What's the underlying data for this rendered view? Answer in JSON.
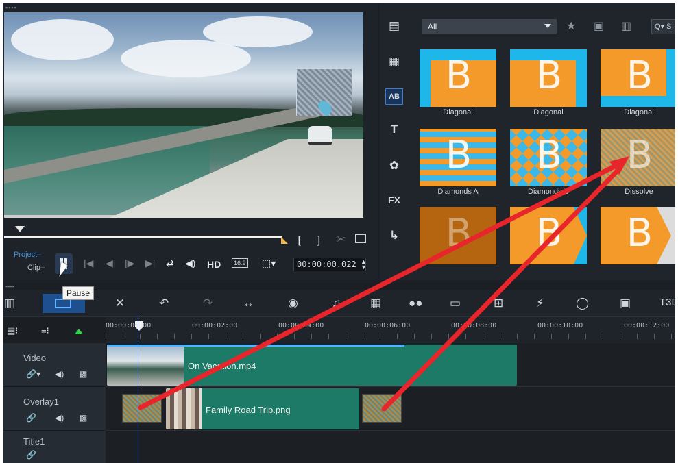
{
  "preview": {
    "mode_project": "Project",
    "mode_clip": "Clip",
    "tooltip": "Pause",
    "hd_label": "HD",
    "ratio_label": "16:9",
    "timecode": "00:00:00.022",
    "mark_in": "[",
    "mark_out": "]"
  },
  "library": {
    "filter_value": "All",
    "search_label": "Q▾ S",
    "rail_icons": [
      "media-icon",
      "instant-project-icon",
      "transition-icon",
      "title-icon",
      "graphics-icon",
      "filter-fx-icon",
      "path-icon"
    ],
    "rail_text": {
      "title": "T",
      "fx": "FX",
      "transition": "AB"
    },
    "tiles": [
      {
        "label": "Diagonal"
      },
      {
        "label": "Diagonal"
      },
      {
        "label": "Diagonal"
      },
      {
        "label": "Diamonds A"
      },
      {
        "label": "Diamonds B"
      },
      {
        "label": "Dissolve"
      },
      {
        "label": ""
      },
      {
        "label": ""
      },
      {
        "label": ""
      }
    ],
    "tile_letter": "B"
  },
  "timeline": {
    "ruler_labels": [
      "00:00:00:00",
      "00:00:02:00",
      "00:00:04:00",
      "00:00:06:00",
      "00:00:08:00",
      "00:00:10:00",
      "00:00:12:00"
    ],
    "tracks": [
      {
        "name": "Video"
      },
      {
        "name": "Overlay1"
      },
      {
        "name": "Title1"
      }
    ],
    "clips": {
      "video_clip": "On Vacation.mp4",
      "overlay_clip": "Family Road Trip.png"
    },
    "toolbar_icons": [
      "storyboard-view-icon",
      "timeline-view-icon",
      "tools-icon",
      "undo-icon",
      "redo-icon",
      "fit-project-icon",
      "record-capture-icon",
      "sound-mixer-icon",
      "multi-camera-icon",
      "color-icon",
      "subtitle-icon",
      "split-screen-icon",
      "motion-tracking-icon",
      "mask-icon",
      "pan-zoom-icon",
      "3d-title-icon"
    ],
    "t3d_label": "T3D"
  },
  "colors": {
    "accent": "#3d7bd2",
    "clip_teal": "#1d7a66",
    "transition_orange": "#f49a2a",
    "transition_cyan": "#1fb6ea",
    "annotation_red": "#e8252b",
    "add_green": "#37d04a"
  }
}
